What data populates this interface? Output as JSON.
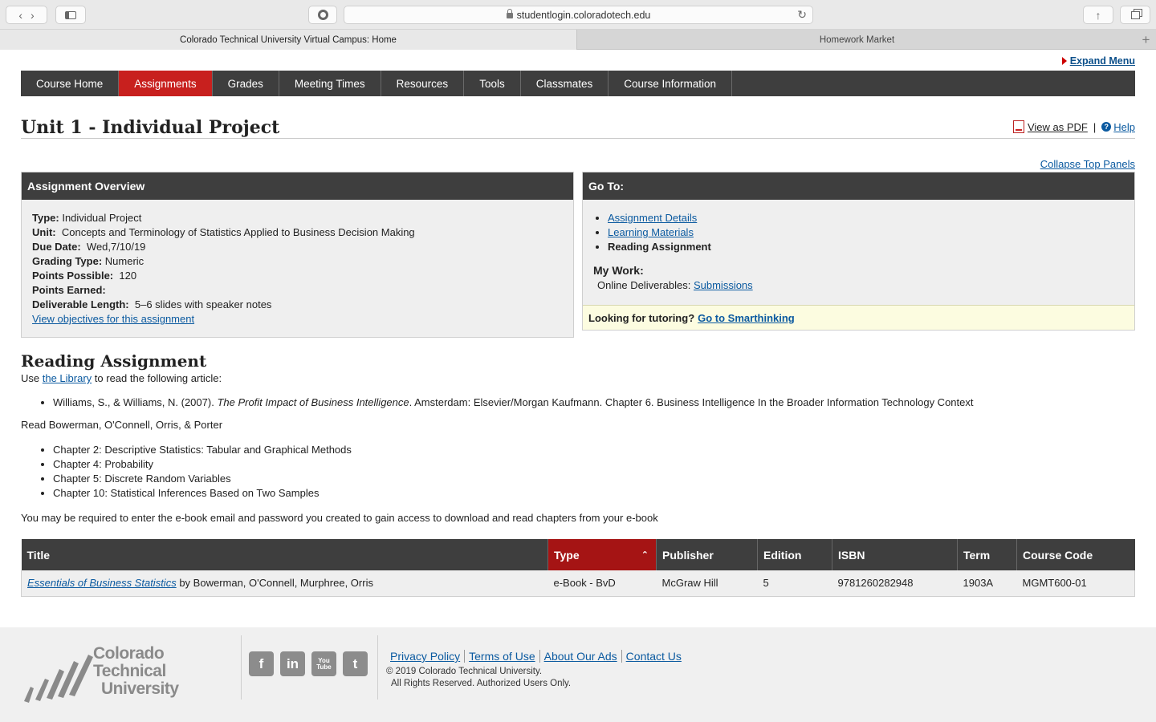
{
  "browser": {
    "url": "studentlogin.coloradotech.edu",
    "tabs": [
      {
        "label": "Colorado Technical University Virtual Campus: Home"
      },
      {
        "label": "Homework Market"
      }
    ]
  },
  "expand_menu": "Expand Menu",
  "nav": [
    {
      "label": "Course Home"
    },
    {
      "label": "Assignments"
    },
    {
      "label": "Grades"
    },
    {
      "label": "Meeting Times"
    },
    {
      "label": "Resources"
    },
    {
      "label": "Tools"
    },
    {
      "label": "Classmates"
    },
    {
      "label": "Course Information"
    }
  ],
  "page": {
    "title": "Unit 1 - Individual Project",
    "view_pdf": "View as PDF",
    "separator": "|",
    "help": "Help",
    "collapse": "Collapse Top Panels"
  },
  "overview": {
    "heading": "Assignment Overview",
    "type_label": "Type:",
    "type_value": "Individual Project",
    "unit_label": "Unit:",
    "unit_value": "Concepts and Terminology of Statistics Applied to Business Decision Making",
    "due_label": "Due Date:",
    "due_value": "Wed,7/10/19",
    "grading_label": "Grading Type:",
    "grading_value": "Numeric",
    "points_possible_label": "Points Possible:",
    "points_possible_value": "120",
    "points_earned_label": "Points Earned:",
    "length_label": "Deliverable Length:",
    "length_value": "5–6 slides with speaker notes",
    "objectives_link": "View objectives for this assignment"
  },
  "goto": {
    "heading": "Go To:",
    "items": [
      "Assignment Details",
      "Learning Materials",
      "Reading Assignment"
    ],
    "mywork_heading": "My Work:",
    "deliverables_label": "Online Deliverables:",
    "submissions_link": "Submissions",
    "tutoring_label": "Looking for tutoring?",
    "tutoring_link": "Go to Smarthinking"
  },
  "reading": {
    "heading": "Reading Assignment",
    "use_prefix": "Use",
    "library_link": "the Library",
    "use_suffix": "to read the following article:",
    "article_authors": "Williams, S., & Williams, N. (2007).",
    "article_title": "The Profit Impact of Business Intelligence",
    "article_rest": ". Amsterdam: Elsevier/Morgan Kaufmann. Chapter 6. Business Intelligence In the Broader Information Technology Context",
    "read_line": "Read Bowerman, O'Connell, Orris, & Porter",
    "chapters": [
      "Chapter 2: Descriptive Statistics: Tabular and Graphical Methods",
      "Chapter 4: Probability",
      "Chapter 5: Discrete Random Variables",
      "Chapter 10: Statistical Inferences Based on Two Samples"
    ],
    "ebook_note": "You may be required to enter the e-book email and password you created to gain access to download and read chapters from your e-book"
  },
  "books_table": {
    "columns": [
      "Title",
      "Type",
      "Publisher",
      "Edition",
      "ISBN",
      "Term",
      "Course Code"
    ],
    "rows": [
      {
        "title_link": "Essentials of Business Statistics",
        "title_suffix": "by Bowerman, O'Connell, Murphree, Orris",
        "type": "e-Book - BvD",
        "publisher": "McGraw Hill",
        "edition": "5",
        "isbn": "9781260282948",
        "term": "1903A",
        "course_code": "MGMT600-01"
      }
    ]
  },
  "footer": {
    "logo_lines": [
      "Colorado",
      "Technical",
      "University"
    ],
    "social": [
      {
        "icon": "facebook-icon",
        "glyph": "f"
      },
      {
        "icon": "linkedin-icon",
        "glyph": "in"
      },
      {
        "icon": "youtube-icon",
        "glyph": "You Tube"
      },
      {
        "icon": "twitter-icon",
        "glyph": "t"
      }
    ],
    "links": [
      "Privacy Policy",
      "Terms of Use",
      "About Our Ads",
      "Contact Us"
    ],
    "copyright": "© 2019 Colorado Technical University.",
    "rights": "All Rights Reserved. Authorized Users Only."
  },
  "colors": {
    "nav_bg": "#3e3e3e",
    "active_red": "#c8201e",
    "sorted_header": "#a51414",
    "link_blue": "#0b5aa0",
    "tutor_bg": "#fcfce0"
  }
}
